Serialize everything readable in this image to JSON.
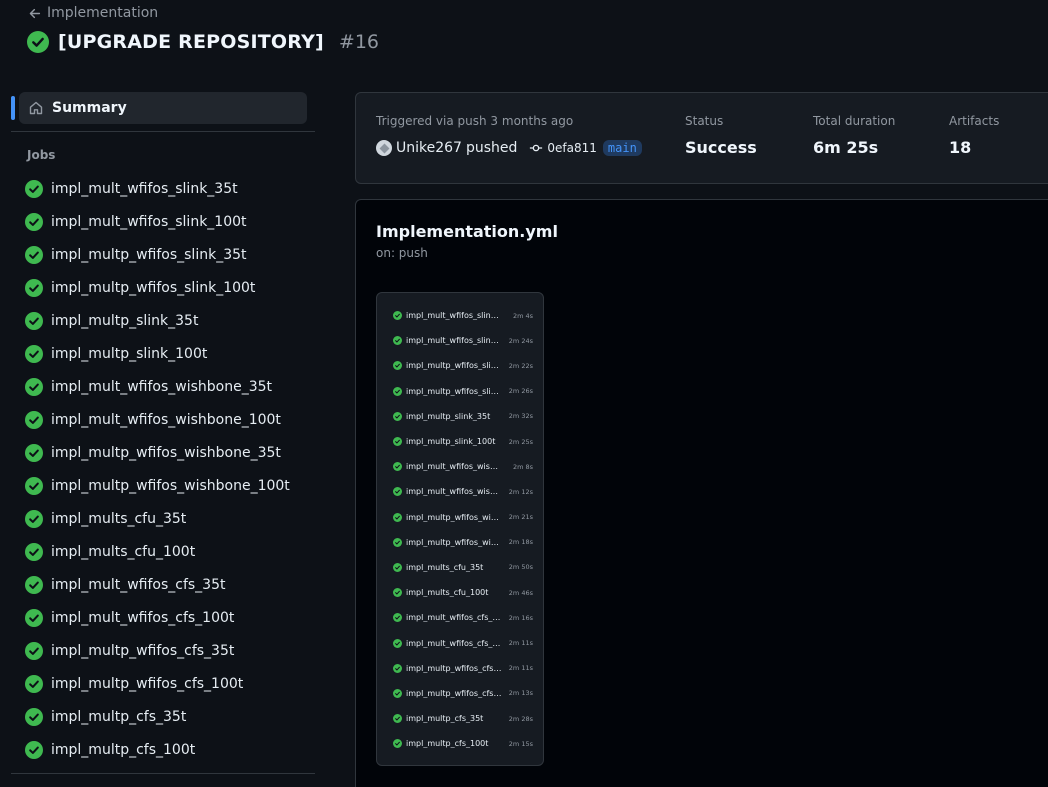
{
  "header": {
    "back_label": "Implementation",
    "title": "[UPGRADE REPOSITORY]",
    "run_number": "#16"
  },
  "sidebar": {
    "summary_label": "Summary",
    "jobs_heading": "Jobs",
    "jobs": [
      {
        "name": "impl_mult_wfifos_slink_35t",
        "status": "success"
      },
      {
        "name": "impl_mult_wfifos_slink_100t",
        "status": "success"
      },
      {
        "name": "impl_multp_wfifos_slink_35t",
        "status": "success"
      },
      {
        "name": "impl_multp_wfifos_slink_100t",
        "status": "success"
      },
      {
        "name": "impl_multp_slink_35t",
        "status": "success"
      },
      {
        "name": "impl_multp_slink_100t",
        "status": "success"
      },
      {
        "name": "impl_mult_wfifos_wishbone_35t",
        "status": "success"
      },
      {
        "name": "impl_mult_wfifos_wishbone_100t",
        "status": "success"
      },
      {
        "name": "impl_multp_wfifos_wishbone_35t",
        "status": "success"
      },
      {
        "name": "impl_multp_wfifos_wishbone_100t",
        "status": "success"
      },
      {
        "name": "impl_mults_cfu_35t",
        "status": "success"
      },
      {
        "name": "impl_mults_cfu_100t",
        "status": "success"
      },
      {
        "name": "impl_mult_wfifos_cfs_35t",
        "status": "success"
      },
      {
        "name": "impl_mult_wfifos_cfs_100t",
        "status": "success"
      },
      {
        "name": "impl_multp_wfifos_cfs_35t",
        "status": "success"
      },
      {
        "name": "impl_multp_wfifos_cfs_100t",
        "status": "success"
      },
      {
        "name": "impl_multp_cfs_35t",
        "status": "success"
      },
      {
        "name": "impl_multp_cfs_100t",
        "status": "success"
      }
    ]
  },
  "summary": {
    "trigger_text": "Triggered via push 3 months ago",
    "user": "Unike267",
    "action": "pushed",
    "commit_sha": "0efa811",
    "branch": "main",
    "status_label": "Status",
    "status_value": "Success",
    "duration_label": "Total duration",
    "duration_value": "6m 25s",
    "artifacts_label": "Artifacts",
    "artifacts_value": "18"
  },
  "workflow": {
    "file": "Implementation.yml",
    "trigger": "on: push",
    "graph_jobs": [
      {
        "name": "impl_mult_wfifos_slink_...",
        "duration": "2m 4s"
      },
      {
        "name": "impl_mult_wfifos_slink...",
        "duration": "2m 24s"
      },
      {
        "name": "impl_multp_wfifos_slin...",
        "duration": "2m 22s"
      },
      {
        "name": "impl_multp_wfifos_slin...",
        "duration": "2m 26s"
      },
      {
        "name": "impl_multp_slink_35t",
        "duration": "2m 32s"
      },
      {
        "name": "impl_multp_slink_100t",
        "duration": "2m 25s"
      },
      {
        "name": "impl_mult_wfifos_wishb...",
        "duration": "2m 8s"
      },
      {
        "name": "impl_mult_wfifos_wish...",
        "duration": "2m 12s"
      },
      {
        "name": "impl_multp_wfifos_wis...",
        "duration": "2m 21s"
      },
      {
        "name": "impl_multp_wfifos_wis...",
        "duration": "2m 18s"
      },
      {
        "name": "impl_mults_cfu_35t",
        "duration": "2m 50s"
      },
      {
        "name": "impl_mults_cfu_100t",
        "duration": "2m 46s"
      },
      {
        "name": "impl_mult_wfifos_cfs_3...",
        "duration": "2m 16s"
      },
      {
        "name": "impl_mult_wfifos_cfs_1...",
        "duration": "2m 11s"
      },
      {
        "name": "impl_multp_wfifos_cfs_...",
        "duration": "2m 11s"
      },
      {
        "name": "impl_multp_wfifos_cfs_...",
        "duration": "2m 13s"
      },
      {
        "name": "impl_multp_cfs_35t",
        "duration": "2m 28s"
      },
      {
        "name": "impl_multp_cfs_100t",
        "duration": "2m 15s"
      }
    ]
  },
  "icons": {
    "success": "check-circle-fill-icon",
    "back": "arrow-left-icon",
    "home": "home-icon",
    "commit": "git-commit-icon"
  },
  "colors": {
    "success": "#3fb950",
    "accent": "#4493f8",
    "background": "#0d1117"
  }
}
